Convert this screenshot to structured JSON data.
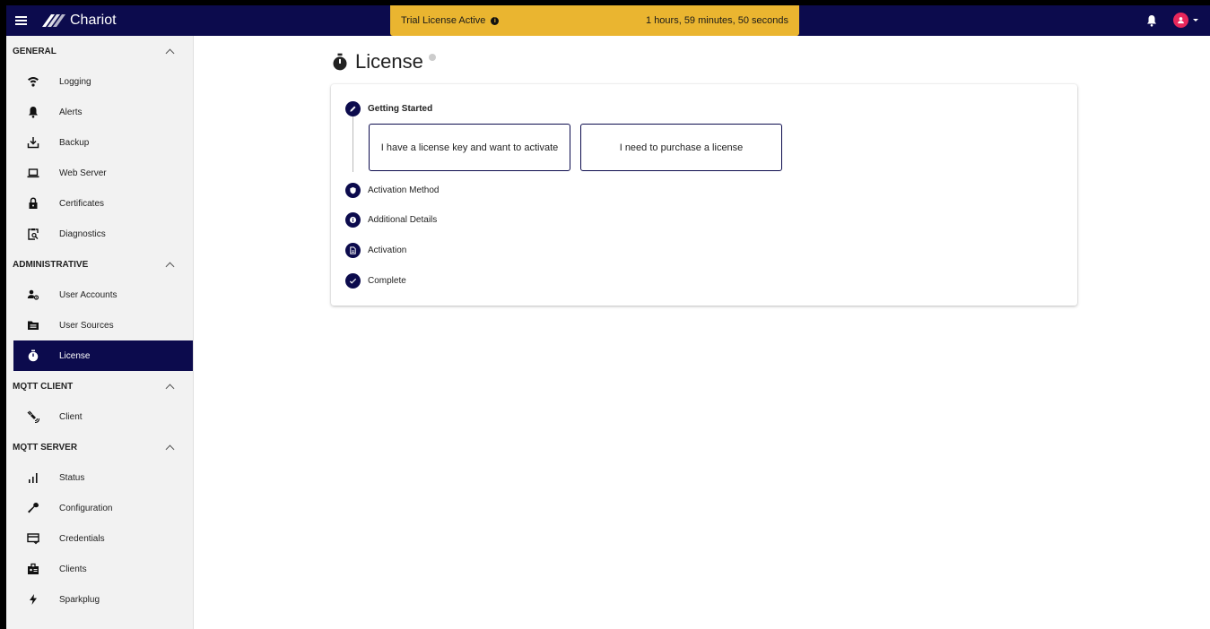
{
  "header": {
    "app_name": "Chariot",
    "trial_label": "Trial License Active",
    "trial_time": "1 hours, 59 minutes, 50 seconds",
    "accent": "#0c0b4d",
    "banner_color": "#eab530",
    "avatar_color": "#e8275b"
  },
  "sidebar": {
    "sections": [
      {
        "label": "GENERAL",
        "items": [
          {
            "label": "Logging",
            "icon": "wifi-icon"
          },
          {
            "label": "Alerts",
            "icon": "bell-icon"
          },
          {
            "label": "Backup",
            "icon": "download-icon"
          },
          {
            "label": "Web Server",
            "icon": "laptop-icon"
          },
          {
            "label": "Certificates",
            "icon": "lock-icon"
          },
          {
            "label": "Diagnostics",
            "icon": "clipboard-search-icon"
          }
        ]
      },
      {
        "label": "ADMINISTRATIVE",
        "items": [
          {
            "label": "User Accounts",
            "icon": "user-gear-icon"
          },
          {
            "label": "User Sources",
            "icon": "folder-icon"
          },
          {
            "label": "License",
            "icon": "timer-icon",
            "active": true
          }
        ]
      },
      {
        "label": "MQTT CLIENT",
        "items": [
          {
            "label": "Client",
            "icon": "satellite-icon"
          }
        ]
      },
      {
        "label": "MQTT SERVER",
        "items": [
          {
            "label": "Status",
            "icon": "bar-chart-icon"
          },
          {
            "label": "Configuration",
            "icon": "wrench-icon"
          },
          {
            "label": "Credentials",
            "icon": "card-icon"
          },
          {
            "label": "Clients",
            "icon": "badge-icon"
          },
          {
            "label": "Sparkplug",
            "icon": "bolt-icon"
          }
        ]
      }
    ]
  },
  "main": {
    "title": "License",
    "steps": [
      {
        "label": "Getting Started",
        "icon": "pencil-icon"
      },
      {
        "label": "Activation Method",
        "icon": "shield-icon"
      },
      {
        "label": "Additional Details",
        "icon": "info-icon"
      },
      {
        "label": "Activation",
        "icon": "document-icon"
      },
      {
        "label": "Complete",
        "icon": "check-icon"
      }
    ],
    "options": {
      "activate": "I have a license key and want to activate",
      "purchase": "I need to purchase a license"
    }
  }
}
